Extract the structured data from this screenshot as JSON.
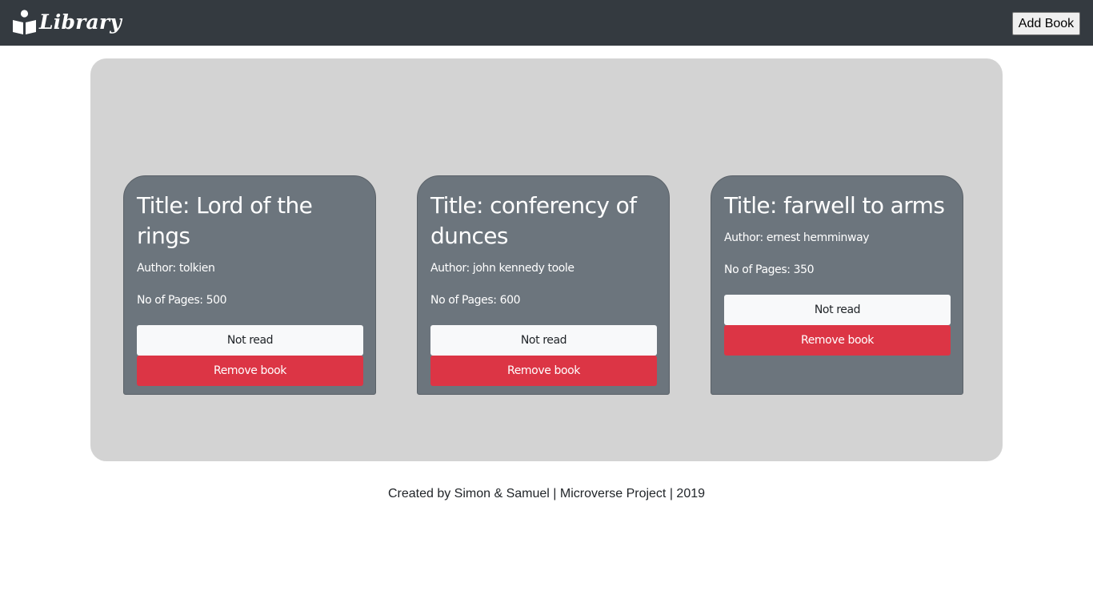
{
  "navbar": {
    "brand_icon": "book-reader-icon",
    "brand_text": "Library",
    "add_book_label": "Add Book"
  },
  "books": [
    {
      "title": "Title: Lord of the rings",
      "author": "Author: tolkien",
      "pages": "No of Pages: 500",
      "read_label": "Not read",
      "remove_label": "Remove book"
    },
    {
      "title": "Title: conferency of dunces",
      "author": "Author: john kennedy toole",
      "pages": "No of Pages: 600",
      "read_label": "Not read",
      "remove_label": "Remove book"
    },
    {
      "title": "Title: farwell to arms",
      "author": "Author: ernest hemminway",
      "pages": "No of Pages: 350",
      "read_label": "Not read",
      "remove_label": "Remove book"
    }
  ],
  "footer": {
    "text": "Created by Simon & Samuel | Microverse Project | 2019"
  },
  "colors": {
    "navbar_bg": "#343a40",
    "shelf_bg": "#d3d3d3",
    "card_bg": "#6c757d",
    "danger": "#dc3545",
    "light": "#f8f9fa"
  }
}
